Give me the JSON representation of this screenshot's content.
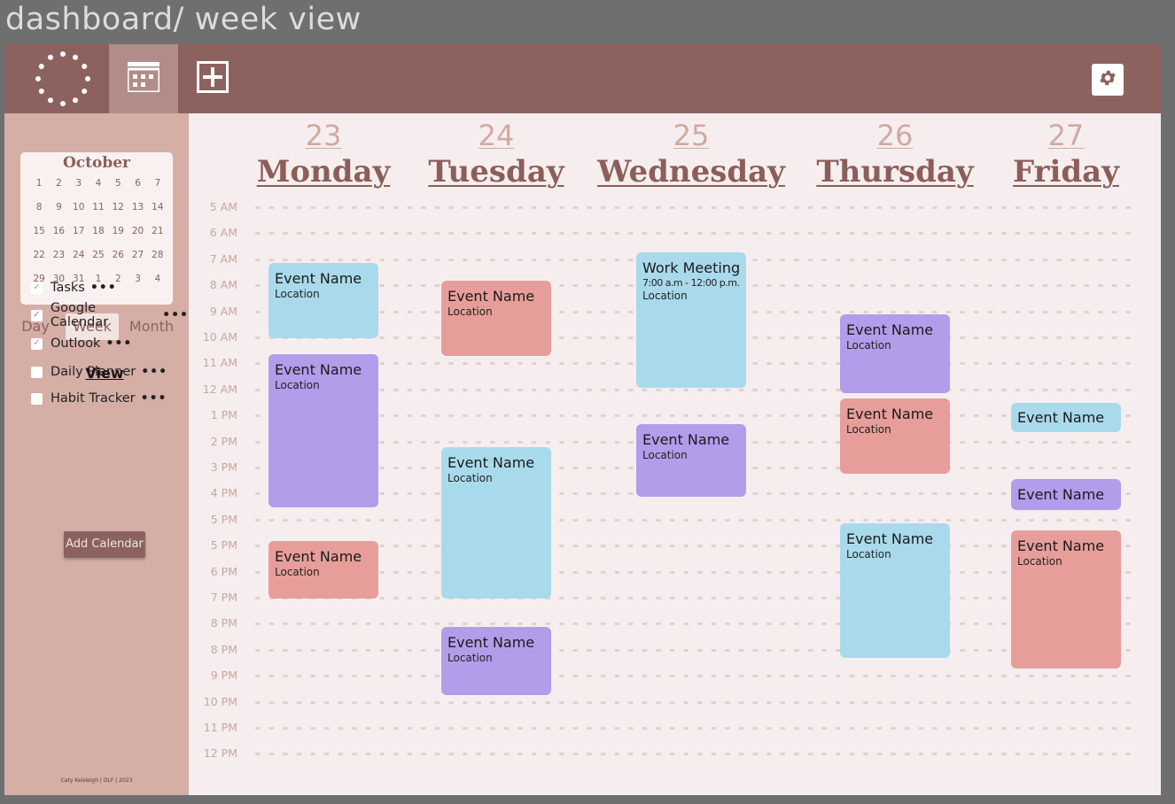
{
  "frame_title": "dashboard/ week view",
  "toolbar": {
    "logo_icon": "dotted-circle-icon",
    "calendar_icon": "calendar-grid-icon",
    "add_icon": "plus-icon",
    "settings_icon": "gear-icon"
  },
  "sidebar": {
    "mini_calendar": {
      "month": "October",
      "days": [
        "1",
        "2",
        "3",
        "4",
        "5",
        "6",
        "7",
        "8",
        "9",
        "10",
        "11",
        "12",
        "13",
        "14",
        "15",
        "16",
        "17",
        "18",
        "19",
        "20",
        "21",
        "22",
        "23",
        "24",
        "25",
        "26",
        "27",
        "28",
        "29",
        "30",
        "31",
        "1",
        "2",
        "3",
        "4"
      ]
    },
    "view_modes": [
      "Day",
      "Week",
      "Month"
    ],
    "selected_view_mode": "Week",
    "view_label": "View",
    "calendars": [
      {
        "label": "Tasks",
        "checked": true,
        "color": "#5fb3d9"
      },
      {
        "label": "Google Calendar",
        "checked": true,
        "color": "#8e6fd8"
      },
      {
        "label": "Outlook",
        "checked": true,
        "color": "#d97f7a"
      },
      {
        "label": "Daily Planner",
        "checked": false,
        "color": "#ffffff"
      },
      {
        "label": "Habit Tracker",
        "checked": false,
        "color": "#ffffff"
      }
    ],
    "more_label": "•••",
    "add_calendar_label": "Add Calendar",
    "footer_note": "Caty Keisleigh | DLF | 2023"
  },
  "week": {
    "days": [
      {
        "num": "23",
        "name": "Monday"
      },
      {
        "num": "24",
        "name": "Tuesday"
      },
      {
        "num": "25",
        "name": "Wednesday"
      },
      {
        "num": "26",
        "name": "Thursday"
      },
      {
        "num": "27",
        "name": "Friday"
      }
    ],
    "hours": [
      "5 AM",
      "6 AM",
      "7 AM",
      "8 AM",
      "9 AM",
      "10 AM",
      "11 AM",
      "12 AM",
      "1 PM",
      "2 PM",
      "3 PM",
      "4 PM",
      "5 PM",
      "5 PM",
      "6 PM",
      "7 PM",
      "8 PM",
      "8 PM",
      "9 PM",
      "10 PM",
      "11 PM",
      "12 PM"
    ]
  },
  "events": [
    {
      "day": 0,
      "start": 2.3,
      "end": 5.2,
      "color": "blue",
      "name": "Event Name",
      "location": "Location"
    },
    {
      "day": 0,
      "start": 5.8,
      "end": 11.7,
      "color": "purple",
      "name": "Event Name",
      "location": "Location"
    },
    {
      "day": 0,
      "start": 13.0,
      "end": 15.2,
      "color": "red",
      "name": "Event Name",
      "location": "Location"
    },
    {
      "day": 1,
      "start": 3.0,
      "end": 5.9,
      "color": "red",
      "name": "Event Name",
      "location": "Location"
    },
    {
      "day": 1,
      "start": 9.4,
      "end": 15.2,
      "color": "blue",
      "name": "Event Name",
      "location": "Location"
    },
    {
      "day": 1,
      "start": 16.3,
      "end": 18.9,
      "color": "purple",
      "name": "Event Name",
      "location": "Location"
    },
    {
      "day": 2,
      "start": 1.9,
      "end": 7.1,
      "color": "blue",
      "name": "Work Meeting",
      "time": "7:00 a.m - 12:00 p.m.",
      "location": "Location"
    },
    {
      "day": 2,
      "start": 8.5,
      "end": 11.3,
      "color": "purple",
      "name": "Event Name",
      "location": "Location"
    },
    {
      "day": 3,
      "start": 4.3,
      "end": 7.3,
      "color": "purple",
      "name": "Event Name",
      "location": "Location"
    },
    {
      "day": 3,
      "start": 7.5,
      "end": 10.4,
      "color": "red",
      "name": "Event Name",
      "location": "Location"
    },
    {
      "day": 3,
      "start": 12.3,
      "end": 17.5,
      "color": "blue",
      "name": "Event Name",
      "location": "Location"
    },
    {
      "day": 4,
      "start": 7.7,
      "end": 8.8,
      "color": "blue",
      "name": "Event Name"
    },
    {
      "day": 4,
      "start": 10.6,
      "end": 11.8,
      "color": "purple",
      "name": "Event Name"
    },
    {
      "day": 4,
      "start": 12.6,
      "end": 17.9,
      "color": "red",
      "name": "Event Name",
      "location": "Location"
    }
  ]
}
